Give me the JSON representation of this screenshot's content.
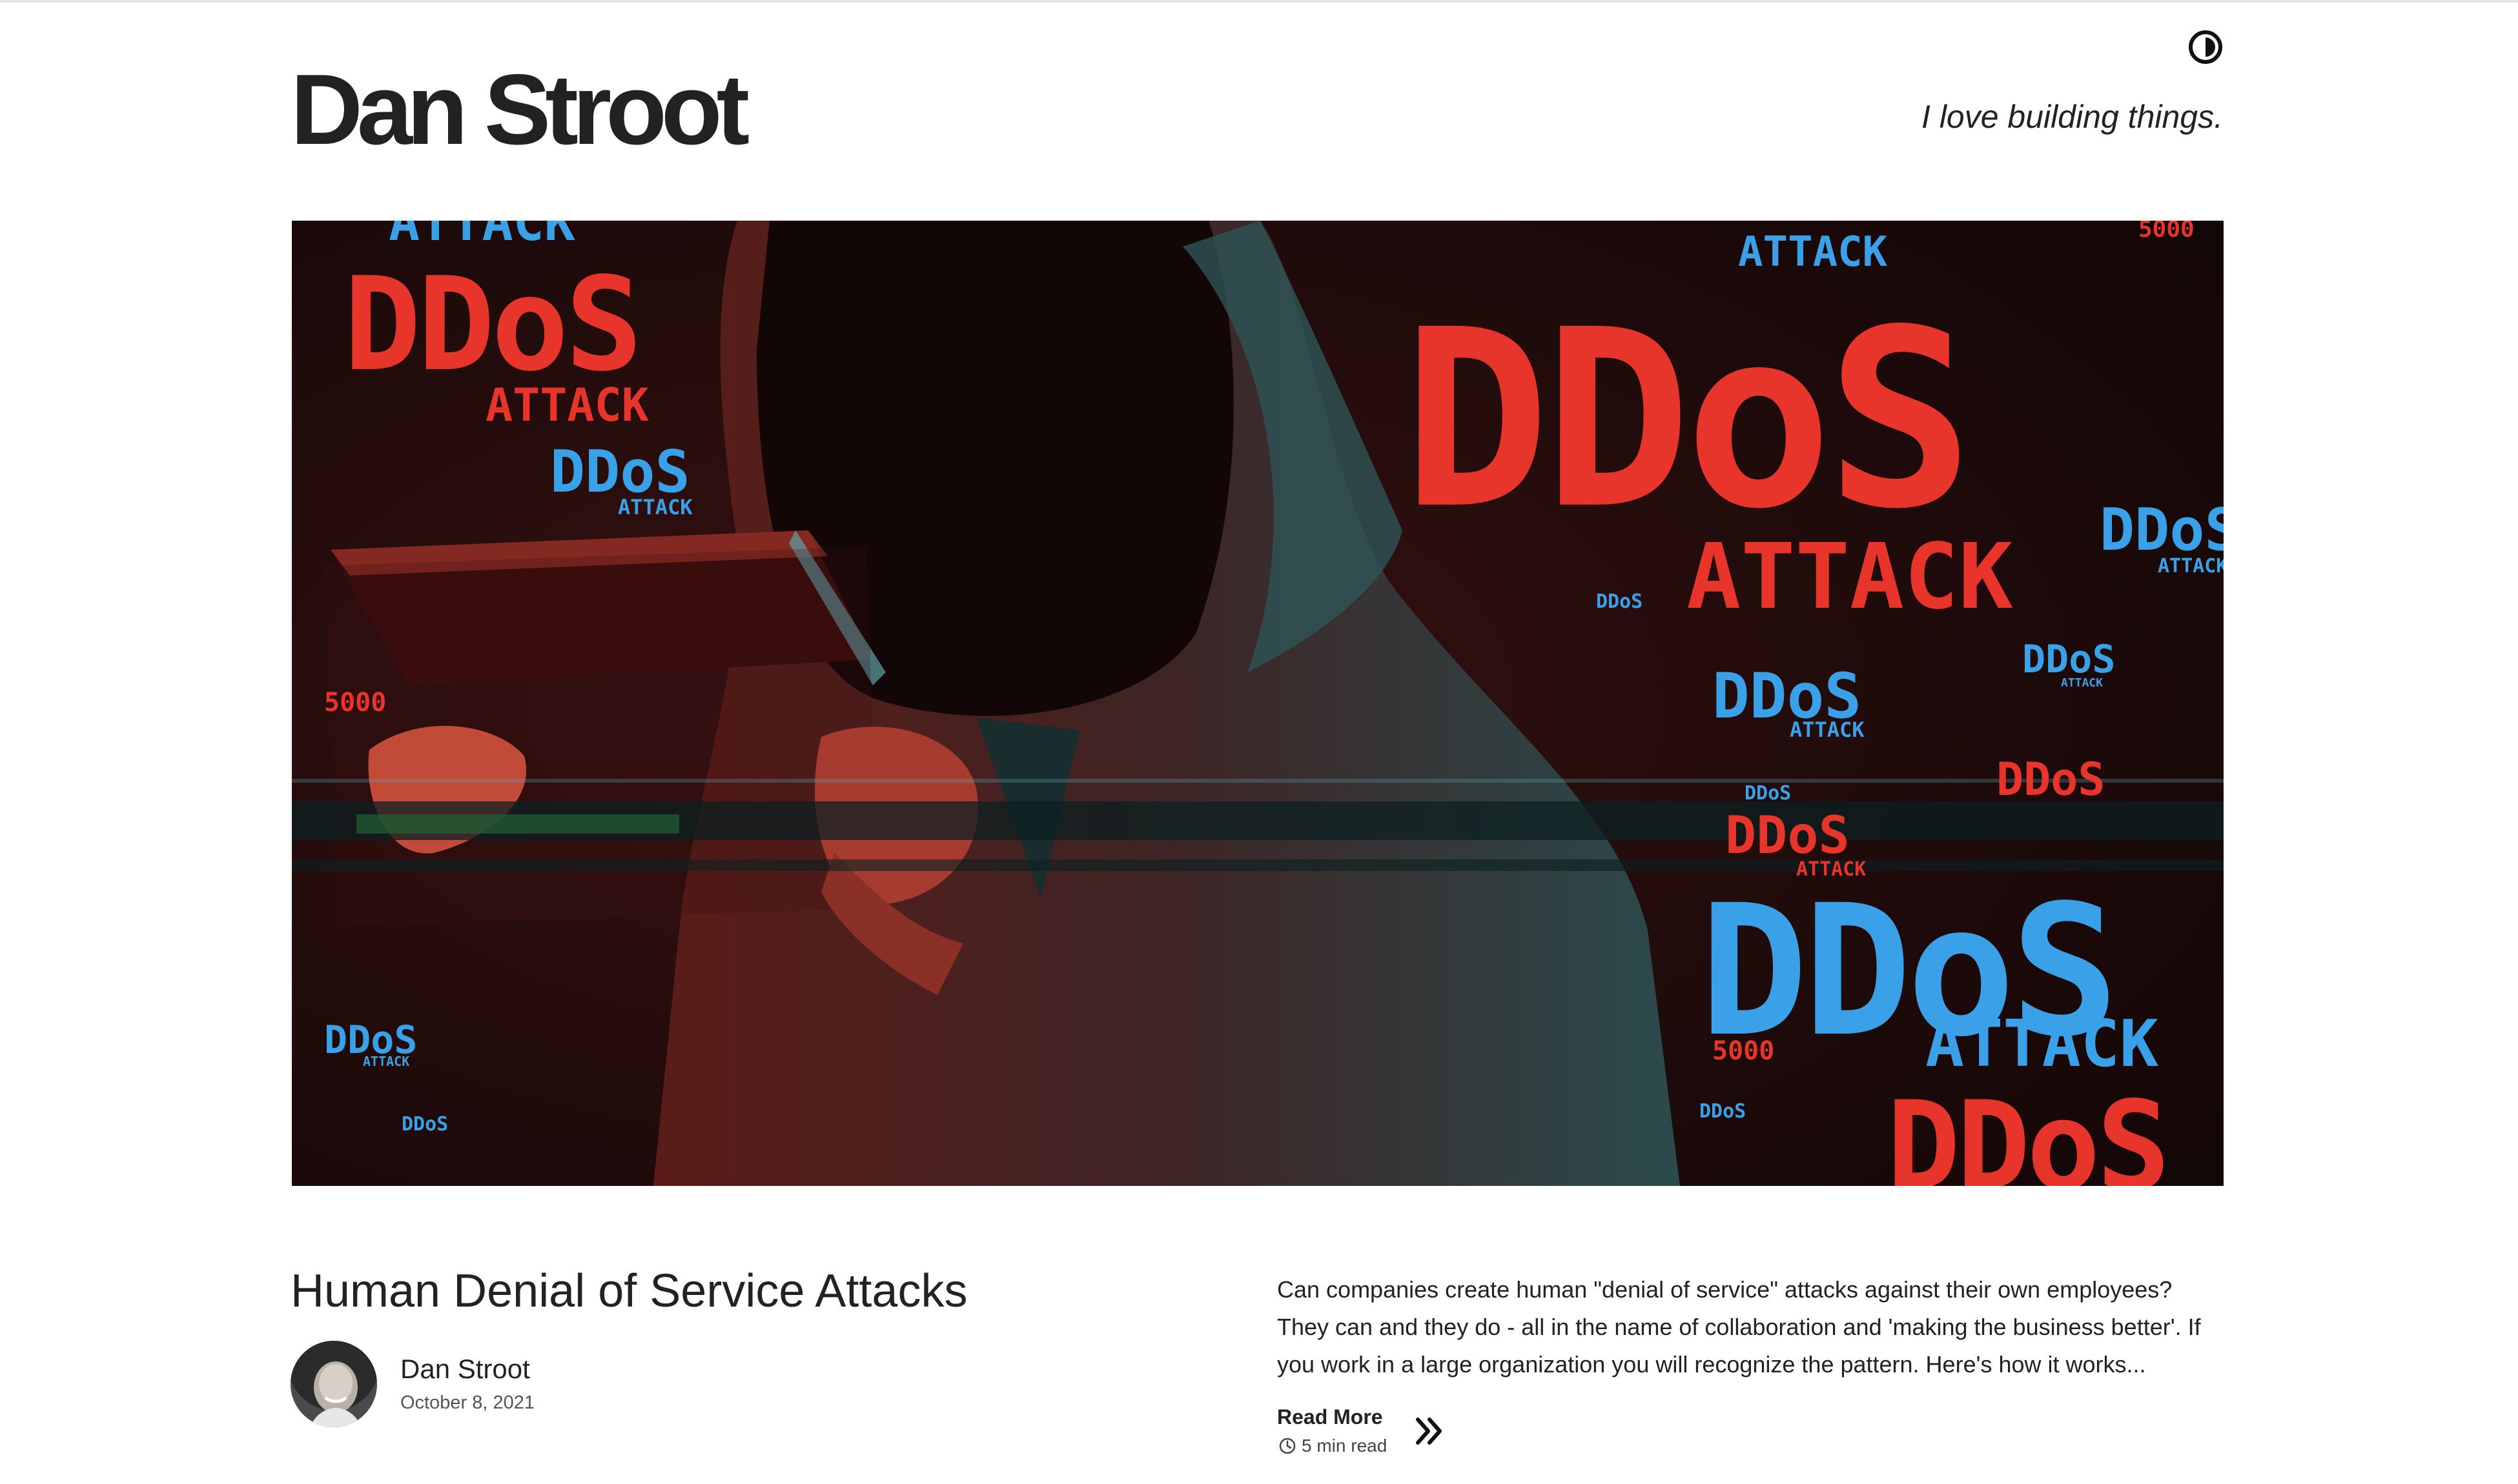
{
  "site": {
    "title": "Dan Stroot",
    "tagline": "I love building things."
  },
  "header": {
    "theme_toggle_icon": "contrast-half-circle-icon"
  },
  "hero": {
    "alt": "Hooded figure holding a tablet with glitchy DDoS ATTACK text in red and blue",
    "texts": {
      "big_red": "DDoS",
      "attack": "ATTACK",
      "small": "DDoS"
    }
  },
  "post": {
    "title": "Human Denial of Service Attacks",
    "author": "Dan Stroot",
    "date": "October 8, 2021",
    "excerpt": "Can companies create human \"denial of service\" attacks against their own employees? They can and they do - all in the name of collaboration and 'making the business better'. If you work in a large organization you will recognize the pattern. Here's how it works...",
    "read_more": "Read More",
    "read_time": "5 min read",
    "clock_icon": "clock-icon",
    "arrow_icon": "double-chevron-right-icon"
  },
  "colors": {
    "red": "#e8352b",
    "blue": "#3aa1e8",
    "background": "#ffffff",
    "text": "#222222"
  }
}
